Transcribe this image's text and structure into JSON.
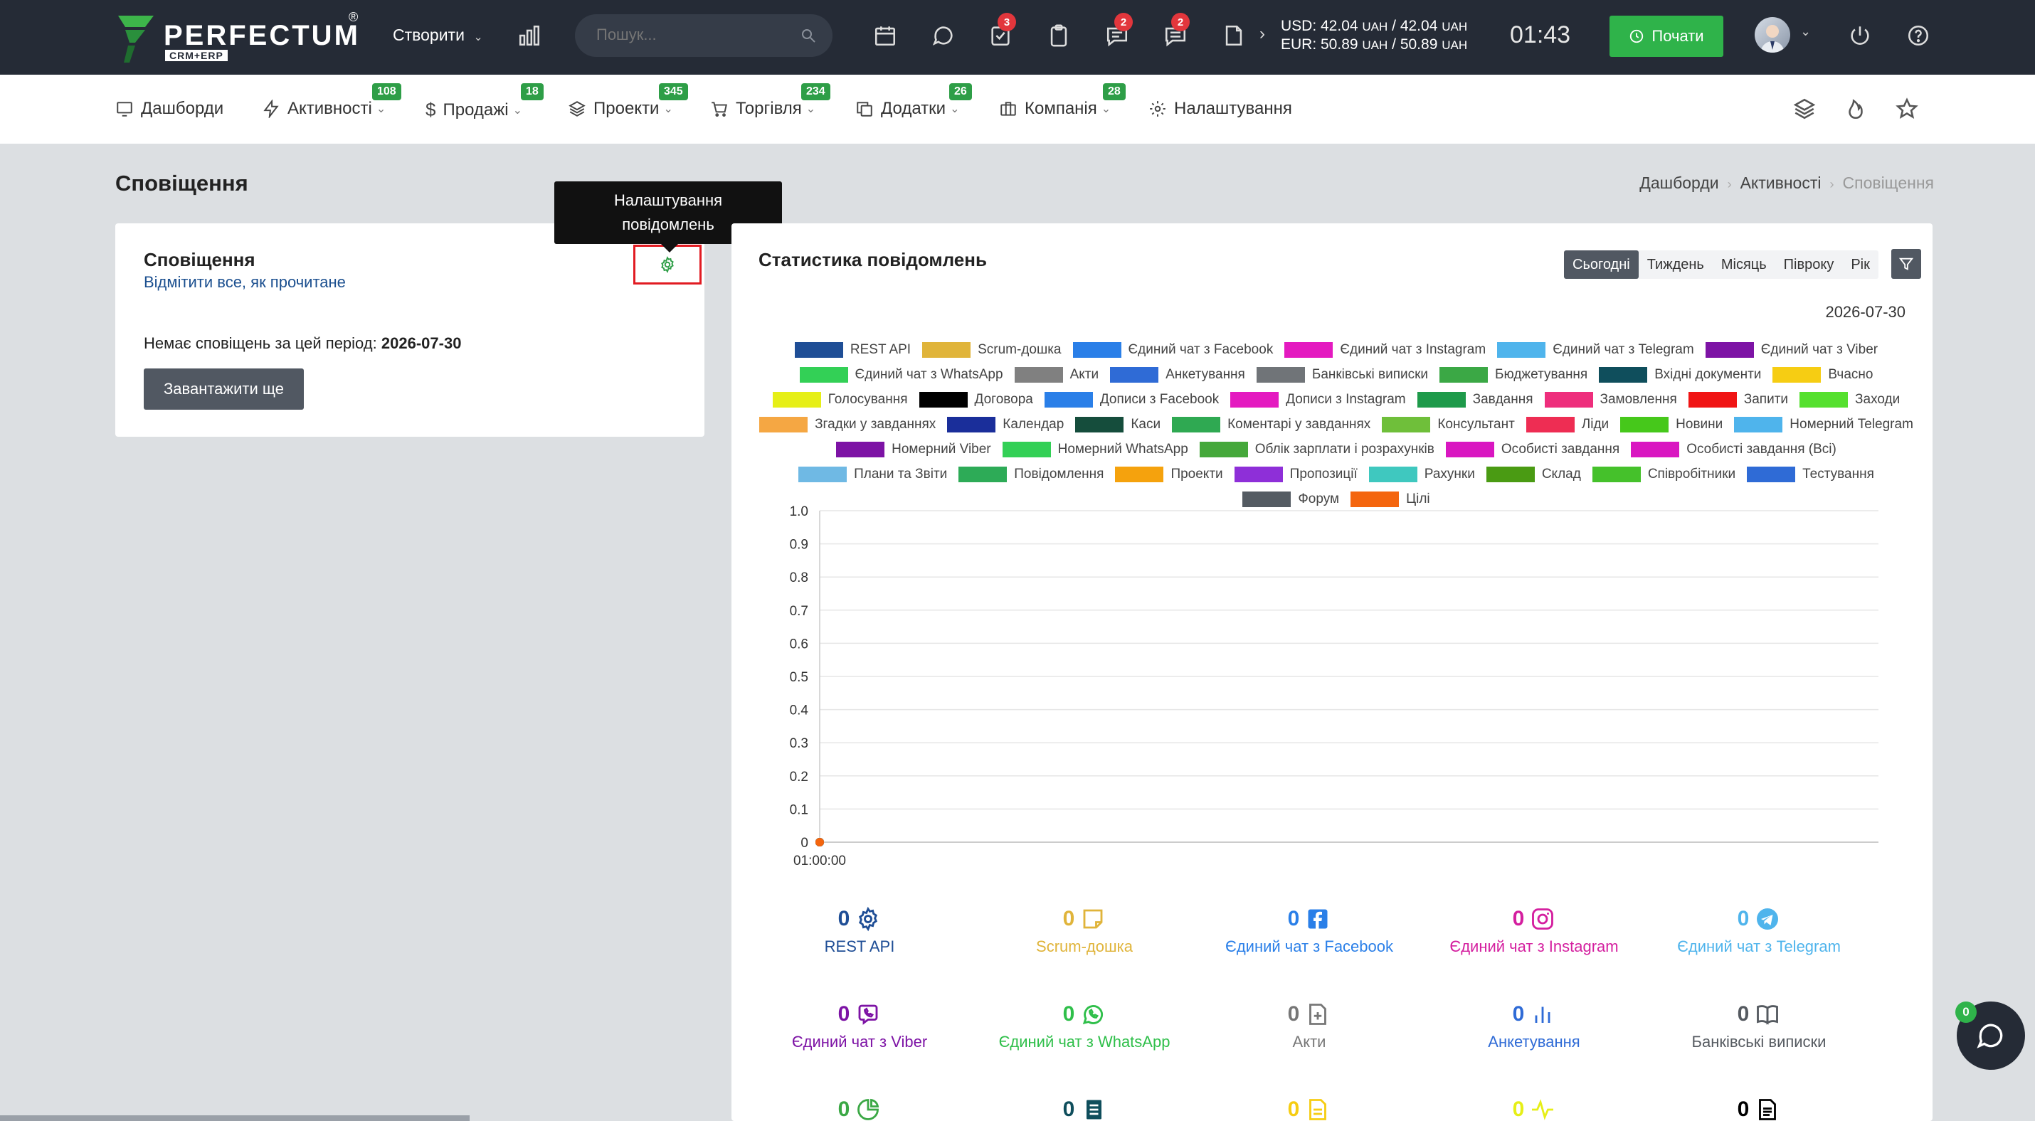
{
  "topbar": {
    "brand": "PERFECTUM",
    "brand_reg": "®",
    "brand_sub": "CRM+ERP",
    "create_label": "Створити",
    "search_placeholder": "Пошук...",
    "badges": {
      "tasks": "3",
      "chat": "2",
      "messages": "2"
    },
    "currency_usd": "USD: 42.04",
    "currency_usd_unit1": "UAH",
    "currency_usd_sep": " / 42.04",
    "currency_usd_unit2": "UAH",
    "currency_eur": "EUR: 50.89",
    "currency_eur_unit1": "UAH",
    "currency_eur_sep": " / 50.89",
    "currency_eur_unit2": "UAH",
    "clock": "01:43",
    "start_label": "Почати",
    "icons": [
      "chart-icon",
      "calendar-icon",
      "chat-icon",
      "tasks-icon",
      "clipboard-icon",
      "message-icon",
      "notes-icon",
      "file-icon",
      "power-icon",
      "help-icon"
    ]
  },
  "nav": {
    "items": [
      {
        "label": "Дашборди",
        "badge": null
      },
      {
        "label": "Активності",
        "badge": "108"
      },
      {
        "label": "Продажі",
        "badge": "18"
      },
      {
        "label": "Проекти",
        "badge": "345"
      },
      {
        "label": "Торгівля",
        "badge": "234"
      },
      {
        "label": "Додатки",
        "badge": "26"
      },
      {
        "label": "Компанія",
        "badge": "28"
      },
      {
        "label": "Налаштування",
        "badge": null
      }
    ]
  },
  "page": {
    "title": "Сповіщення",
    "breadcrumbs": [
      "Дашборди",
      "Активності",
      "Сповіщення"
    ]
  },
  "left_card": {
    "title": "Сповіщення",
    "mark_all": "Відмітити все, як прочитане",
    "empty_text": "Немає сповіщень за цей період:",
    "empty_date": "2026-07-30",
    "load_more": "Завантажити ще",
    "tooltip_line1": "Налаштування",
    "tooltip_line2": "повідомлень"
  },
  "right_card": {
    "title": "Статистика повідомлень",
    "tabs": [
      "Сьогодні",
      "Тиждень",
      "Місяць",
      "Півроку",
      "Рік"
    ],
    "active_tab": "Сьогодні",
    "date": "2026-07-30"
  },
  "chart_data": {
    "type": "line",
    "x": [
      "01:00:00"
    ],
    "ylim": [
      0,
      1.0
    ],
    "yticks": [
      "1.0",
      "0.9",
      "0.8",
      "0.7",
      "0.6",
      "0.5",
      "0.4",
      "0.3",
      "0.2",
      "0.1",
      "0"
    ],
    "series": [
      {
        "name": "REST API",
        "color": "#1f4e96",
        "values": [
          0
        ]
      },
      {
        "name": "Scrum-дошка",
        "color": "#e0b43a",
        "values": [
          0
        ]
      },
      {
        "name": "Єдиний чат з Facebook",
        "color": "#2a7fe8",
        "values": [
          0
        ]
      },
      {
        "name": "Єдиний чат з Instagram",
        "color": "#e41ac0",
        "values": [
          0
        ]
      },
      {
        "name": "Єдиний чат з Telegram",
        "color": "#4fb4ec",
        "values": [
          0
        ]
      },
      {
        "name": "Єдиний чат з Viber",
        "color": "#7d13a5",
        "values": [
          0
        ]
      },
      {
        "name": "Єдиний чат з WhatsApp",
        "color": "#33d056",
        "values": [
          0
        ]
      },
      {
        "name": "Акти",
        "color": "#808080",
        "values": [
          0
        ]
      },
      {
        "name": "Анкетування",
        "color": "#2f6bd6",
        "values": [
          0
        ]
      },
      {
        "name": "Банківські виписки",
        "color": "#707478",
        "values": [
          0
        ]
      },
      {
        "name": "Бюджетування",
        "color": "#3ba845",
        "values": [
          0
        ]
      },
      {
        "name": "Вхідні документи",
        "color": "#0f4e5c",
        "values": [
          0
        ]
      },
      {
        "name": "Вчасно",
        "color": "#f6cd13",
        "values": [
          0
        ]
      },
      {
        "name": "Голосування",
        "color": "#e6ef17",
        "values": [
          0
        ]
      },
      {
        "name": "Договора",
        "color": "#000000",
        "values": [
          0
        ]
      },
      {
        "name": "Дописи з Facebook",
        "color": "#2a7fe8",
        "values": [
          0
        ]
      },
      {
        "name": "Дописи з Instagram",
        "color": "#e41ac0",
        "values": [
          0
        ]
      },
      {
        "name": "Завдання",
        "color": "#1e9a4a",
        "values": [
          0
        ]
      },
      {
        "name": "Замовлення",
        "color": "#ee2e7c",
        "values": [
          0
        ]
      },
      {
        "name": "Запити",
        "color": "#f01414",
        "values": [
          0
        ]
      },
      {
        "name": "Заходи",
        "color": "#55e02e",
        "values": [
          0
        ]
      },
      {
        "name": "Згадки у завданнях",
        "color": "#f5a743",
        "values": [
          0
        ]
      },
      {
        "name": "Календар",
        "color": "#1a2e9a",
        "values": [
          0
        ]
      },
      {
        "name": "Каси",
        "color": "#154d3c",
        "values": [
          0
        ]
      },
      {
        "name": "Коментарі у завданнях",
        "color": "#2fa952",
        "values": [
          0
        ]
      },
      {
        "name": "Консультант",
        "color": "#6fbf3a",
        "values": [
          0
        ]
      },
      {
        "name": "Ліди",
        "color": "#ee2d53",
        "values": [
          0
        ]
      },
      {
        "name": "Новини",
        "color": "#46c81b",
        "values": [
          0
        ]
      },
      {
        "name": "Номерний Telegram",
        "color": "#4fb4ec",
        "values": [
          0
        ]
      },
      {
        "name": "Номерний Viber",
        "color": "#7d13a5",
        "values": [
          0
        ]
      },
      {
        "name": "Номерний WhatsApp",
        "color": "#33d056",
        "values": [
          0
        ]
      },
      {
        "name": "Облік зарплати і розрахунків",
        "color": "#45a83b",
        "values": [
          0
        ]
      },
      {
        "name": "Особисті завдання",
        "color": "#d917c1",
        "values": [
          0
        ]
      },
      {
        "name": "Особисті завдання (Всі)",
        "color": "#d917c1",
        "values": [
          0
        ]
      },
      {
        "name": "Плани та Звіти",
        "color": "#6fb9e4",
        "values": [
          0
        ]
      },
      {
        "name": "Повідомлення",
        "color": "#2dab57",
        "values": [
          0
        ]
      },
      {
        "name": "Проекти",
        "color": "#f5a20d",
        "values": [
          0
        ]
      },
      {
        "name": "Пропозиції",
        "color": "#8e2fd8",
        "values": [
          0
        ]
      },
      {
        "name": "Рахунки",
        "color": "#3fc8bf",
        "values": [
          0
        ]
      },
      {
        "name": "Склад",
        "color": "#4a9b13",
        "values": [
          0
        ]
      },
      {
        "name": "Співробітники",
        "color": "#45c12b",
        "values": [
          0
        ]
      },
      {
        "name": "Тестування",
        "color": "#2f6bd6",
        "values": [
          0
        ]
      },
      {
        "name": "Форум",
        "color": "#545b62",
        "values": [
          0
        ]
      },
      {
        "name": "Цілі",
        "color": "#f4650e",
        "values": [
          0
        ]
      }
    ]
  },
  "stats": [
    {
      "value": "0",
      "label": "REST API",
      "icon": "gear-icon",
      "color": "#1f4e96"
    },
    {
      "value": "0",
      "label": "Scrum-дошка",
      "icon": "sticky-note-icon",
      "color": "#e0b43a"
    },
    {
      "value": "0",
      "label": "Єдиний чат з Facebook",
      "icon": "facebook-icon",
      "color": "#2a7fe8"
    },
    {
      "value": "0",
      "label": "Єдиний чат з Instagram",
      "icon": "instagram-icon",
      "color": "#d41f9f"
    },
    {
      "value": "0",
      "label": "Єдиний чат з Telegram",
      "icon": "telegram-icon",
      "color": "#4fb4ec"
    },
    {
      "value": "0",
      "label": "Єдиний чат з Viber",
      "icon": "viber-icon",
      "color": "#7d13a5"
    },
    {
      "value": "0",
      "label": "Єдиний чат з WhatsApp",
      "icon": "whatsapp-icon",
      "color": "#2fbf4a"
    },
    {
      "value": "0",
      "label": "Акти",
      "icon": "file-plus-icon",
      "color": "#777777"
    },
    {
      "value": "0",
      "label": "Анкетування",
      "icon": "bar-chart-icon",
      "color": "#2f6bd6"
    },
    {
      "value": "0",
      "label": "Банківські виписки",
      "icon": "book-icon",
      "color": "#555a60"
    },
    {
      "value": "0",
      "label": "",
      "icon": "pie-icon",
      "color": "#3ba845"
    },
    {
      "value": "0",
      "label": "",
      "icon": "doc-list-icon",
      "color": "#0f4e5c"
    },
    {
      "value": "0",
      "label": "",
      "icon": "doc-icon",
      "color": "#f6cd13"
    },
    {
      "value": "0",
      "label": "",
      "icon": "pulse-icon",
      "color": "#e6ef17"
    },
    {
      "value": "0",
      "label": "",
      "icon": "doc-text-icon",
      "color": "#000000"
    }
  ],
  "chat_fab_badge": "0"
}
